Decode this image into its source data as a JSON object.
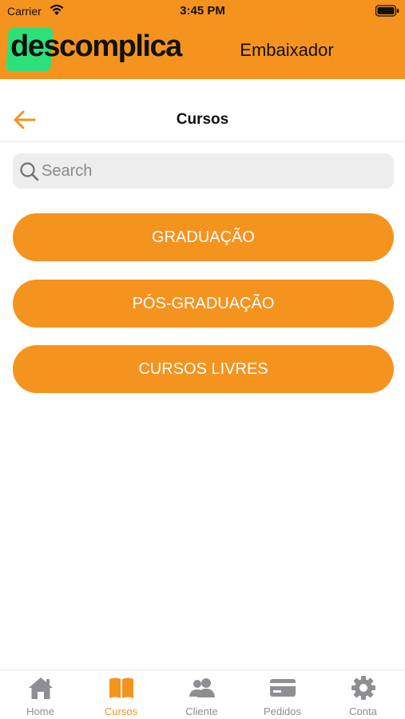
{
  "status_bar": {
    "carrier": "Carrier",
    "time": "3:45 PM"
  },
  "header": {
    "logo_part1": "des",
    "logo_part2": "complica",
    "title": "Embaixador"
  },
  "nav": {
    "title": "Cursos"
  },
  "search": {
    "placeholder": "Search"
  },
  "buttons": [
    {
      "label": "GRADUAÇÃO"
    },
    {
      "label": "PÓS-GRADUAÇÃO"
    },
    {
      "label": "CURSOS LIVRES"
    }
  ],
  "tabs": [
    {
      "label": "Home",
      "icon": "home-icon",
      "active": false
    },
    {
      "label": "Cursos",
      "icon": "book-icon",
      "active": true
    },
    {
      "label": "Cliente",
      "icon": "users-icon",
      "active": false
    },
    {
      "label": "Pedidos",
      "icon": "card-icon",
      "active": false
    },
    {
      "label": "Conta",
      "icon": "gear-icon",
      "active": false
    }
  ],
  "colors": {
    "accent": "#f5931f",
    "logo_green": "#2de07a",
    "inactive": "#8e8e93"
  }
}
